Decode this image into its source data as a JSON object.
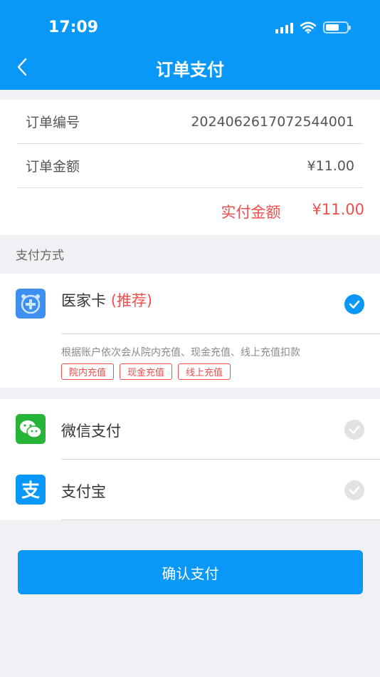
{
  "status_bar": {
    "time": "17:09"
  },
  "header": {
    "title": "订单支付"
  },
  "order": {
    "number_label": "订单编号",
    "number_value": "2024062617072544001",
    "amount_label": "订单金额",
    "amount_value": "¥11.00",
    "paid_label": "实付金额",
    "paid_value": "¥11.00"
  },
  "payment": {
    "section_label": "支付方式",
    "card": {
      "name": "医家卡",
      "recommend": "(推荐)",
      "description": "根据账户依次会从院内充值、现金充值、线上充值扣款",
      "tags": [
        "院内充值",
        "现金充值",
        "线上充值"
      ],
      "selected": true
    },
    "wechat": {
      "name": "微信支付",
      "selected": false
    },
    "alipay": {
      "name": "支付宝",
      "selected": false
    }
  },
  "confirm_label": "确认支付",
  "colors": {
    "primary": "#0a98f8",
    "accent_red": "#f04d4d",
    "background": "#f0f0f5"
  }
}
